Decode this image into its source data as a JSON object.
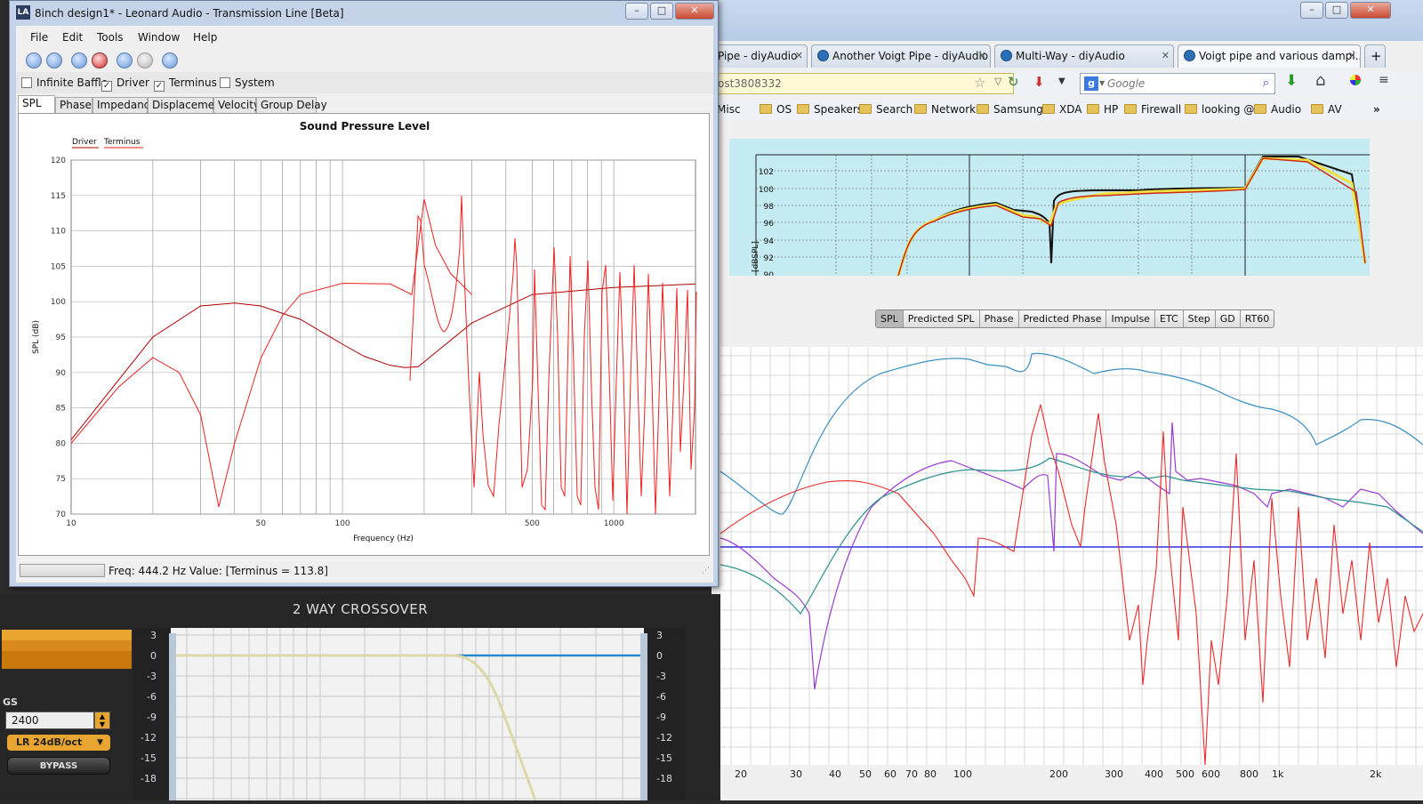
{
  "browser": {
    "tabs": [
      {
        "label": "Pipe - diyAudio"
      },
      {
        "label": "Another Voigt Pipe - diyAudio"
      },
      {
        "label": "Multi-Way - diyAudio"
      },
      {
        "label": "Voigt pipe and various dampi..."
      }
    ],
    "url": "ost3808332",
    "search_placeholder": "Google",
    "bookmarks": [
      "Misc",
      "OS",
      "Speakers",
      "Search",
      "Network",
      "Samsung",
      "XDA",
      "HP",
      "Firewall",
      "looking @",
      "Audio",
      "AV"
    ],
    "top_chart": {
      "ylabel": "[dBSPL]",
      "yticks": [
        "102",
        "100",
        "98",
        "96",
        "94",
        "92",
        "90"
      ]
    }
  },
  "rew": {
    "tabs": [
      "SPL",
      "Predicted SPL",
      "Phase",
      "Predicted Phase",
      "Impulse",
      "ETC",
      "Step",
      "GD",
      "RT60"
    ],
    "active_tab": "SPL",
    "xticks": [
      "20",
      "30",
      "40",
      "50",
      "60",
      "70",
      "80",
      "100",
      "200",
      "300",
      "400",
      "500",
      "600",
      "800",
      "1k",
      "2k"
    ],
    "colors": {
      "blue": "#3a8fc0",
      "purple": "#9a3ad0",
      "teal": "#2a9090",
      "red": "#ee2a2a",
      "ref": "#3030e0"
    }
  },
  "crossover": {
    "title": "2 WAY CROSSOVER",
    "section_label": "GS",
    "frequency": "2400",
    "slope": "LR 24dB/oct",
    "bypass": "BYPASS",
    "yticks": [
      "3",
      "0",
      "-3",
      "-6",
      "-9",
      "-12",
      "-15",
      "-18"
    ]
  },
  "la": {
    "title": "8inch design1* - Leonard Audio - Transmission Line [Beta]",
    "logo": "LA",
    "menu": [
      "File",
      "Edit",
      "Tools",
      "Window",
      "Help"
    ],
    "checks": [
      {
        "label": "Infinite Baffle",
        "checked": false
      },
      {
        "label": "Driver",
        "checked": true
      },
      {
        "label": "Terminus",
        "checked": true
      },
      {
        "label": "System",
        "checked": false
      }
    ],
    "tabs": [
      "SPL",
      "Phase",
      "Impedance",
      "Displacement",
      "Velocity",
      "Group Delay"
    ],
    "active_tab": "SPL",
    "status": "Freq: 444.2 Hz   Value: [Terminus = 113.8]",
    "chart": {
      "title": "Sound Pressure Level",
      "xlabel": "Frequency (Hz)",
      "ylabel": "SPL (dB)",
      "legend": [
        "Driver",
        "Terminus"
      ],
      "xticks": [
        "10",
        "50",
        "100",
        "500",
        "1000"
      ],
      "yticks": [
        "120",
        "115",
        "110",
        "105",
        "100",
        "95",
        "90",
        "85",
        "80",
        "75",
        "70"
      ]
    }
  },
  "chart_data": {
    "type": "line",
    "title": "Sound Pressure Level",
    "xlabel": "Frequency (Hz)",
    "ylabel": "SPL (dB)",
    "xscale": "log",
    "xlim": [
      10,
      2000
    ],
    "ylim": [
      70,
      120
    ],
    "series": [
      {
        "name": "Driver",
        "x": [
          10,
          15,
          20,
          30,
          40,
          50,
          70,
          100,
          120,
          150,
          170,
          190,
          200,
          300,
          500,
          1000,
          2000
        ],
        "y": [
          80.5,
          89,
          95,
          99.4,
          99.8,
          99.4,
          97.5,
          94,
          92.3,
          91,
          90.7,
          90.8,
          91.5,
          97,
          101,
          102,
          102.5
        ]
      },
      {
        "name": "Terminus",
        "x": [
          10,
          15,
          20,
          25,
          30,
          35,
          40,
          50,
          60,
          70,
          100,
          150,
          180,
          200,
          220,
          250,
          300
        ],
        "y": [
          80,
          88,
          92.1,
          90,
          84,
          71,
          80,
          92,
          98,
          101,
          102.6,
          102.5,
          101,
          114.5,
          108,
          104,
          101
        ]
      }
    ]
  }
}
